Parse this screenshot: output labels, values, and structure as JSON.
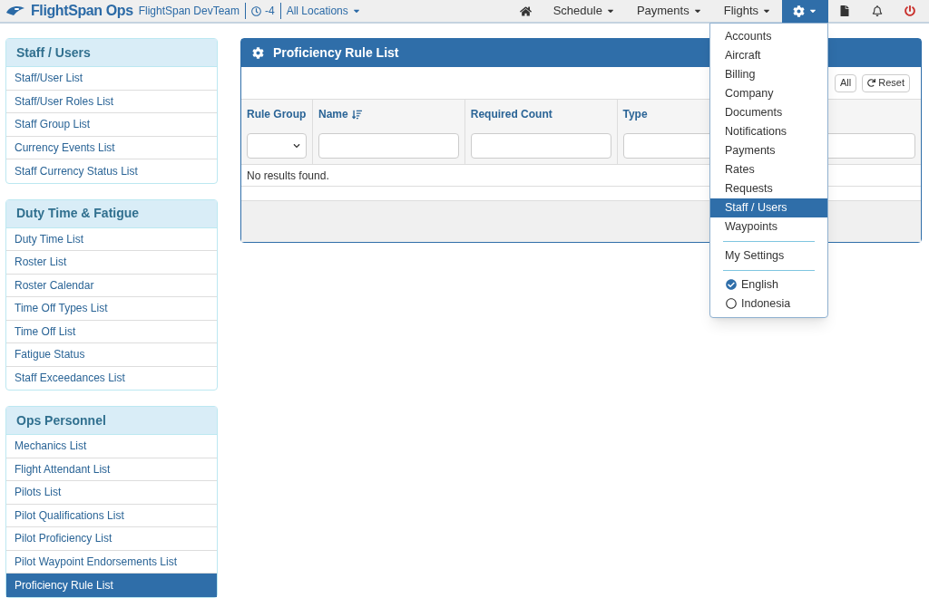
{
  "topbar": {
    "brand_main": "FlightSpan",
    "brand_suffix": "Ops",
    "team": "FlightSpan DevTeam",
    "timezone": "-4",
    "location": "All Locations",
    "nav": [
      {
        "kind": "home",
        "selected": false
      },
      {
        "kind": "menu",
        "label": "Schedule",
        "selected": false
      },
      {
        "kind": "menu",
        "label": "Payments",
        "selected": false
      },
      {
        "kind": "menu",
        "label": "Flights",
        "selected": false
      },
      {
        "kind": "settings",
        "selected": true
      },
      {
        "kind": "document",
        "selected": false
      },
      {
        "kind": "bell",
        "selected": false
      },
      {
        "kind": "power",
        "selected": false
      }
    ]
  },
  "settings_menu": {
    "items": [
      {
        "kind": "item",
        "label": "Accounts",
        "selected": false
      },
      {
        "kind": "item",
        "label": "Aircraft",
        "selected": false
      },
      {
        "kind": "item",
        "label": "Billing",
        "selected": false
      },
      {
        "kind": "item",
        "label": "Company",
        "selected": false
      },
      {
        "kind": "item",
        "label": "Documents",
        "selected": false
      },
      {
        "kind": "item",
        "label": "Notifications",
        "selected": false
      },
      {
        "kind": "item",
        "label": "Payments",
        "selected": false
      },
      {
        "kind": "item",
        "label": "Rates",
        "selected": false
      },
      {
        "kind": "item",
        "label": "Requests",
        "selected": false
      },
      {
        "kind": "item",
        "label": "Staff / Users",
        "selected": true
      },
      {
        "kind": "item",
        "label": "Waypoints",
        "selected": false
      },
      {
        "kind": "divider"
      },
      {
        "kind": "item",
        "label": "My Settings",
        "selected": false
      },
      {
        "kind": "divider"
      },
      {
        "kind": "radio",
        "label": "English",
        "selected": true
      },
      {
        "kind": "radio",
        "label": "Indonesia",
        "selected": false
      }
    ]
  },
  "sidebar": [
    {
      "title": "Staff / Users",
      "items": [
        {
          "label": "Staff/User List",
          "selected": false
        },
        {
          "label": "Staff/User Roles List",
          "selected": false
        },
        {
          "label": "Staff Group List",
          "selected": false
        },
        {
          "label": "Currency Events List",
          "selected": false
        },
        {
          "label": "Staff Currency Status List",
          "selected": false
        }
      ]
    },
    {
      "title": "Duty Time & Fatigue",
      "items": [
        {
          "label": "Duty Time List",
          "selected": false
        },
        {
          "label": "Roster List",
          "selected": false
        },
        {
          "label": "Roster Calendar",
          "selected": false
        },
        {
          "label": "Time Off Types List",
          "selected": false
        },
        {
          "label": "Time Off List",
          "selected": false
        },
        {
          "label": "Fatigue Status",
          "selected": false
        },
        {
          "label": "Staff Exceedances List",
          "selected": false
        }
      ]
    },
    {
      "title": "Ops Personnel",
      "items": [
        {
          "label": "Mechanics List",
          "selected": false
        },
        {
          "label": "Flight Attendant List",
          "selected": false
        },
        {
          "label": "Pilots List",
          "selected": false
        },
        {
          "label": "Pilot Qualifications List",
          "selected": false
        },
        {
          "label": "Pilot Proficiency List",
          "selected": false
        },
        {
          "label": "Pilot Waypoint Endorsements List",
          "selected": false
        },
        {
          "label": "Proficiency Rule List",
          "selected": true
        }
      ]
    }
  ],
  "panel": {
    "title": "Proficiency Rule List",
    "toolbar_buttons": [
      {
        "kind": "plain",
        "label": "All"
      },
      {
        "kind": "reset",
        "label": "Reset"
      }
    ],
    "columns": [
      {
        "label": "Rule Group",
        "kind": "select",
        "sorted": false
      },
      {
        "label": "Name",
        "kind": "input",
        "sorted": true
      },
      {
        "label": "Required Count",
        "kind": "input",
        "sorted": false
      },
      {
        "label": "Type",
        "kind": "input",
        "sorted": false
      },
      {
        "kind": "input",
        "sorted": false
      }
    ],
    "empty_message": "No results found."
  }
}
